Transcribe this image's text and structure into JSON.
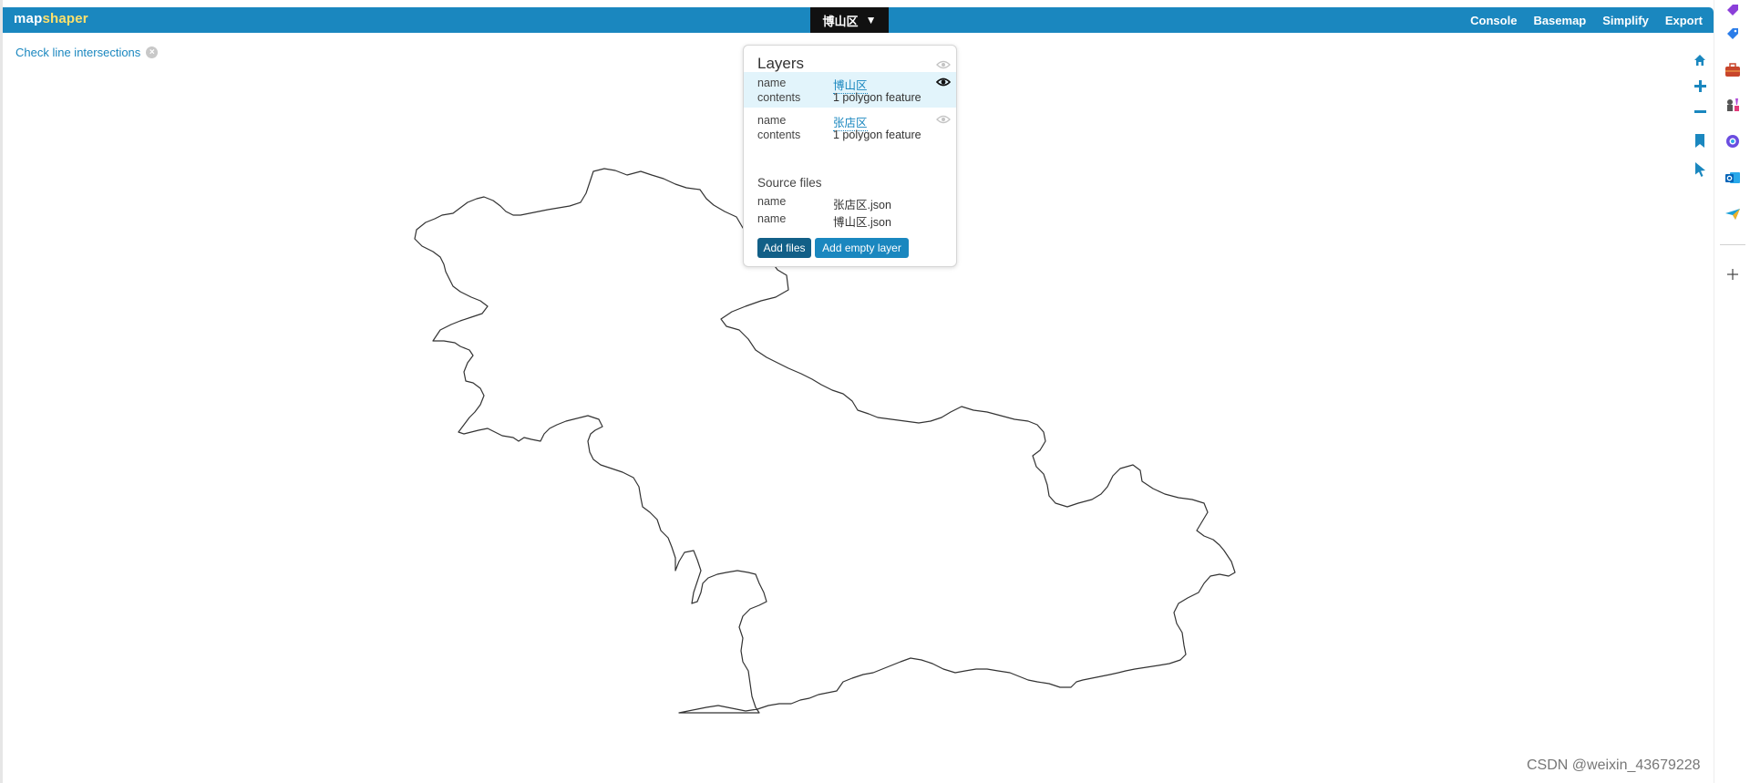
{
  "app": {
    "logo_part1": "map",
    "logo_part2": "shaper",
    "current_layer": "博山区",
    "dropdown_arrow": "▼",
    "menu": [
      "Console",
      "Basemap",
      "Simplify",
      "Export"
    ]
  },
  "intersections": {
    "label": "Check line intersections",
    "close": "×"
  },
  "layers_panel": {
    "title": "Layers",
    "layers": [
      {
        "name_key": "name",
        "name": "博山区",
        "contents_key": "contents",
        "contents": "1 polygon feature",
        "visible": true,
        "active": true
      },
      {
        "name_key": "name",
        "name": "张店区",
        "contents_key": "contents",
        "contents": "1 polygon feature",
        "visible": false,
        "active": false
      }
    ],
    "source_title": "Source files",
    "sources": [
      {
        "key": "name",
        "file": "张店区.json"
      },
      {
        "key": "name",
        "file": "博山区.json"
      }
    ],
    "add_files": "Add files",
    "add_empty_layer": "Add empty layer"
  },
  "tools": [
    "home-icon",
    "zoom-in-icon",
    "zoom-out-icon",
    "bookmark-icon",
    "pointer-icon"
  ],
  "extension_icons": [
    "shopping-tag-icon",
    "toolbox-icon",
    "chess-icon",
    "copilot-icon",
    "outlook-icon",
    "send-icon",
    "plus-icon"
  ],
  "colors": {
    "accent": "#1a87bf",
    "layer_selector_bg": "#111111",
    "logo_highlight": "#ffe16b"
  },
  "watermark": "CSDN @weixin_43679228"
}
